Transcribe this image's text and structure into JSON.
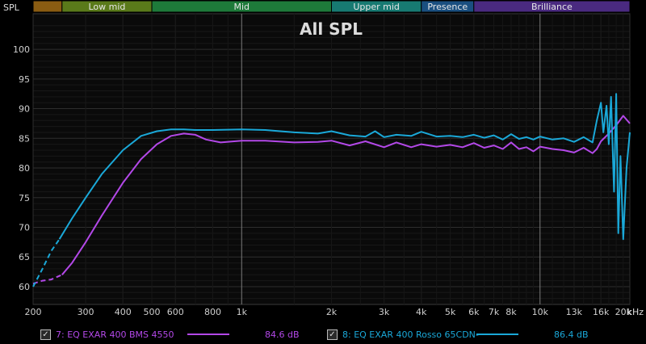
{
  "chart_data": {
    "type": "line",
    "title": "All SPL",
    "ylabel": "SPL",
    "xunit": "kHz",
    "xscale": "log",
    "xlim": [
      200,
      20000
    ],
    "ylim": [
      57,
      106
    ],
    "x_ticks": [
      {
        "v": 200,
        "label": "200"
      },
      {
        "v": 300,
        "label": "300"
      },
      {
        "v": 400,
        "label": "400"
      },
      {
        "v": 500,
        "label": "500"
      },
      {
        "v": 600,
        "label": "600"
      },
      {
        "v": 800,
        "label": "800"
      },
      {
        "v": 1000,
        "label": "1k"
      },
      {
        "v": 2000,
        "label": "2k"
      },
      {
        "v": 3000,
        "label": "3k"
      },
      {
        "v": 4000,
        "label": "4k"
      },
      {
        "v": 5000,
        "label": "5k"
      },
      {
        "v": 6000,
        "label": "6k"
      },
      {
        "v": 7000,
        "label": "7k"
      },
      {
        "v": 8000,
        "label": "8k"
      },
      {
        "v": 10000,
        "label": "10k"
      },
      {
        "v": 13000,
        "label": "13k"
      },
      {
        "v": 16000,
        "label": "16k"
      },
      {
        "v": 20000,
        "label": "20k"
      }
    ],
    "y_ticks": [
      60,
      65,
      70,
      75,
      80,
      85,
      90,
      95,
      100
    ],
    "bands": [
      {
        "name": "",
        "from": 200,
        "to": 250,
        "color": "#8a5c12"
      },
      {
        "name": "Low mid",
        "from": 250,
        "to": 500,
        "color": "#5a7a1a"
      },
      {
        "name": "Mid",
        "from": 500,
        "to": 2000,
        "color": "#1e7a3a"
      },
      {
        "name": "Upper mid",
        "from": 2000,
        "to": 4000,
        "color": "#177a72"
      },
      {
        "name": "Presence",
        "from": 4000,
        "to": 6000,
        "color": "#1a4f80"
      },
      {
        "name": "Brilliance",
        "from": 6000,
        "to": 20000,
        "color": "#4a2a80"
      }
    ],
    "series": [
      {
        "name": "7: EQ EXAR 400 BMS 4550",
        "color": "#b348e8",
        "dashed_until": 250,
        "x": [
          200,
          215,
          230,
          250,
          270,
          300,
          340,
          400,
          460,
          520,
          580,
          640,
          700,
          760,
          850,
          1000,
          1200,
          1500,
          1800,
          2000,
          2300,
          2600,
          3000,
          3300,
          3700,
          4000,
          4500,
          5000,
          5500,
          6000,
          6500,
          7000,
          7500,
          8000,
          8500,
          9000,
          9500,
          10000,
          11000,
          12000,
          13000,
          14000,
          15000,
          15500,
          16000,
          17000,
          18000,
          19000,
          20000
        ],
        "y": [
          60.5,
          61,
          61.2,
          62,
          64,
          67.5,
          72,
          77.5,
          81.5,
          84,
          85.4,
          85.8,
          85.6,
          84.8,
          84.3,
          84.6,
          84.6,
          84.3,
          84.4,
          84.6,
          83.8,
          84.5,
          83.5,
          84.3,
          83.5,
          84.0,
          83.6,
          83.9,
          83.5,
          84.2,
          83.4,
          83.8,
          83.2,
          84.3,
          83.2,
          83.5,
          82.8,
          83.6,
          83.2,
          83.0,
          82.6,
          83.4,
          82.5,
          83.2,
          84.5,
          85.8,
          87.2,
          88.8,
          87.5
        ]
      },
      {
        "name": "8: EQ EXAR 400 Rosso 65CDN-",
        "color": "#1aa8d8",
        "dashed_until": 245,
        "x": [
          200,
          215,
          230,
          245,
          270,
          300,
          340,
          400,
          460,
          520,
          580,
          640,
          700,
          800,
          1000,
          1200,
          1500,
          1800,
          2000,
          2300,
          2600,
          2800,
          3000,
          3300,
          3700,
          4000,
          4500,
          5000,
          5500,
          6000,
          6500,
          7000,
          7500,
          8000,
          8500,
          9000,
          9500,
          10000,
          11000,
          12000,
          13000,
          14000,
          15000,
          15500,
          16000,
          16300,
          16700,
          17000,
          17300,
          17700,
          18000,
          18300,
          18600,
          19000,
          19500,
          20000
        ],
        "y": [
          60.0,
          63,
          66,
          68,
          71.5,
          75,
          79,
          83,
          85.4,
          86.2,
          86.5,
          86.5,
          86.4,
          86.4,
          86.5,
          86.4,
          86.0,
          85.8,
          86.2,
          85.5,
          85.3,
          86.2,
          85.2,
          85.6,
          85.4,
          86.1,
          85.3,
          85.4,
          85.2,
          85.6,
          85.1,
          85.5,
          84.8,
          85.7,
          84.9,
          85.2,
          84.8,
          85.3,
          84.8,
          85.0,
          84.4,
          85.2,
          84.3,
          88,
          91,
          86,
          90.5,
          84,
          92,
          76,
          92.5,
          69,
          82,
          68,
          80,
          86
        ]
      }
    ],
    "legend": [
      {
        "label": "7: EQ EXAR 400 BMS 4550",
        "value": "84.6 dB",
        "checked": true,
        "color": "#b348e8"
      },
      {
        "label": "8: EQ EXAR 400 Rosso 65CDN-",
        "value": "86.4 dB",
        "checked": true,
        "color": "#1aa8d8"
      }
    ]
  }
}
